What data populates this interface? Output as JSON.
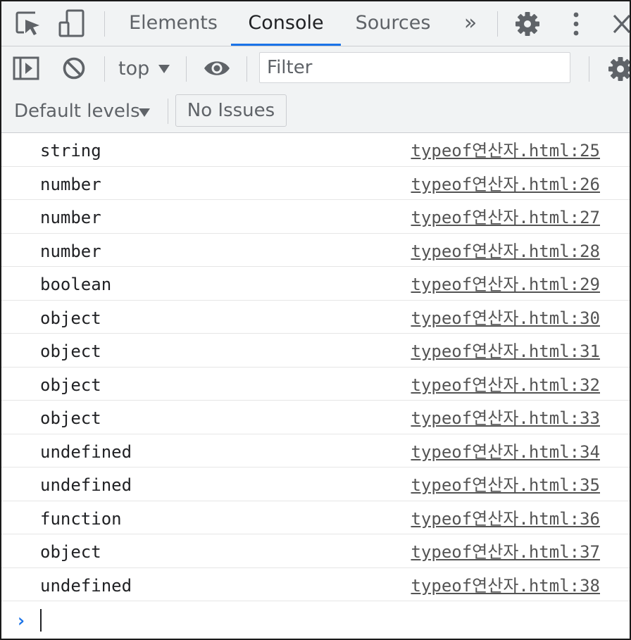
{
  "tabs": {
    "elements": "Elements",
    "console": "Console",
    "sources": "Sources",
    "more": "»"
  },
  "toolbar": {
    "context": "top",
    "filter_placeholder": "Filter",
    "levels": "Default levels",
    "issues": "No Issues"
  },
  "messages": [
    {
      "text": "string",
      "source": "typeof연산자.html:25"
    },
    {
      "text": "number",
      "source": "typeof연산자.html:26"
    },
    {
      "text": "number",
      "source": "typeof연산자.html:27"
    },
    {
      "text": "number",
      "source": "typeof연산자.html:28"
    },
    {
      "text": "boolean",
      "source": "typeof연산자.html:29"
    },
    {
      "text": "object",
      "source": "typeof연산자.html:30"
    },
    {
      "text": "object",
      "source": "typeof연산자.html:31"
    },
    {
      "text": "object",
      "source": "typeof연산자.html:32"
    },
    {
      "text": "object",
      "source": "typeof연산자.html:33"
    },
    {
      "text": "undefined",
      "source": "typeof연산자.html:34"
    },
    {
      "text": "undefined",
      "source": "typeof연산자.html:35"
    },
    {
      "text": "function",
      "source": "typeof연산자.html:36"
    },
    {
      "text": "object",
      "source": "typeof연산자.html:37"
    },
    {
      "text": "undefined",
      "source": "typeof연산자.html:38"
    }
  ],
  "prompt": "›",
  "colors": {
    "accent": "#1a73e8",
    "toolbar_bg": "#f1f3f4",
    "source_link": "#545454"
  },
  "icons": [
    "inspect-icon",
    "device-toolbar-icon",
    "settings-gear-icon",
    "kebab-menu-icon",
    "close-icon",
    "sidebar-toggle-icon",
    "clear-console-icon",
    "dropdown-arrow-icon",
    "eye-icon",
    "console-settings-gear-icon"
  ]
}
